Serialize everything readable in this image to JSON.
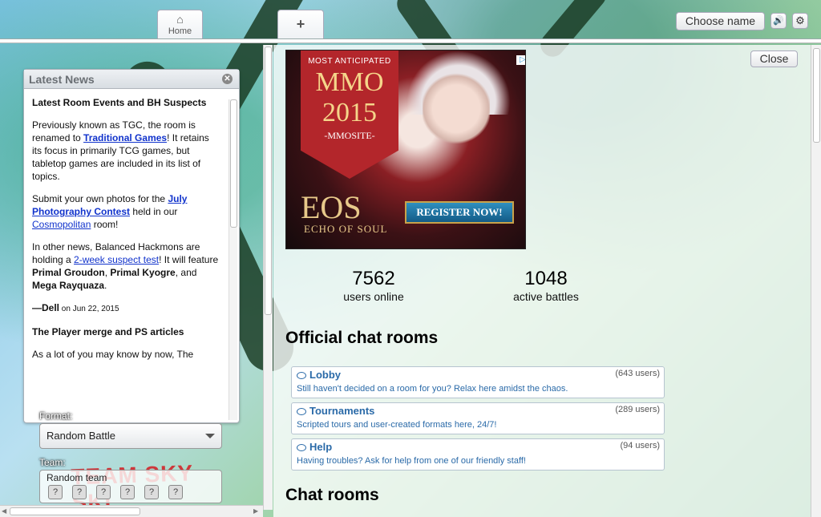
{
  "tabs": {
    "home_label": "Home",
    "new_tab_label": "+"
  },
  "header": {
    "choose_name": "Choose name",
    "sound_icon": "speaker-icon",
    "settings_icon": "gear-icon"
  },
  "news": {
    "title": "Latest News",
    "h1": "Latest Room Events and BH Suspects",
    "p1_a": "Previously known as TGC, the room is renamed to ",
    "p1_link": "Traditional Games",
    "p1_b": "! It retains its focus in primarily TCG games, but tabletop games are included in its list of topics.",
    "p2_a": "Submit your own photos for the ",
    "p2_link": "July Photography Contest",
    "p2_b": " held in our ",
    "p2_link2": "Cosmopolitan",
    "p2_c": " room!",
    "p3_a": "In other news, Balanced Hackmons are holding a ",
    "p3_link": "2-week suspect test",
    "p3_b": "! It will feature ",
    "p3_bold1": "Primal Groudon",
    "p3_c": ", ",
    "p3_bold2": "Primal Kyogre",
    "p3_d": ", and ",
    "p3_bold3": "Mega Rayquaza",
    "p3_e": ".",
    "sign": "—Dell",
    "date": " on Jun 22, 2015",
    "h2": "The Player merge and PS articles",
    "p4": "As a lot of you may know by now, The"
  },
  "form": {
    "format_label": "Format:",
    "format_value": "Random Battle",
    "team_label": "Team:",
    "team_value": "Random team",
    "team_banner": "TEAM SKY SKI",
    "pokemon_slots": [
      "?",
      "?",
      "?",
      "?",
      "?",
      "?"
    ]
  },
  "right": {
    "close": "Close",
    "ad": {
      "line1": "MOST ANTICIPATED",
      "line2": "MMO",
      "line3": "2015",
      "line4": "-MMOSITE-",
      "brand": "EOS",
      "brand_sub": "ECHO OF SOUL",
      "cta": "REGISTER NOW!",
      "adchoice": "▷✕"
    },
    "stats": {
      "users_num": "7562",
      "users_label": "users online",
      "battles_num": "1048",
      "battles_label": "active battles"
    },
    "official_title": "Official chat rooms",
    "rooms": [
      {
        "name": "Lobby",
        "users": "(643 users)",
        "desc": "Still haven't decided on a room for you? Relax here amidst the chaos."
      },
      {
        "name": "Tournaments",
        "users": "(289 users)",
        "desc": "Scripted tours and user-created formats here, 24/7!"
      },
      {
        "name": "Help",
        "users": "(94 users)",
        "desc": "Having troubles? Ask for help from one of our friendly staff!"
      }
    ],
    "chat_title": "Chat rooms"
  }
}
